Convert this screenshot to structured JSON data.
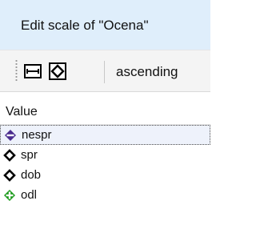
{
  "dialog": {
    "title": "Edit scale of \"Ocena\""
  },
  "toolbar": {
    "buttons": [
      {
        "icon": "fit-width-icon"
      },
      {
        "icon": "diamond-outline-icon"
      }
    ],
    "sort_label": "ascending"
  },
  "list": {
    "column_header": "Value",
    "rows": [
      {
        "label": "nespr",
        "icon": "purple-diamond-minus-icon",
        "selected": true
      },
      {
        "label": "spr",
        "icon": "black-diamond-outline-icon",
        "selected": false
      },
      {
        "label": "dob",
        "icon": "black-diamond-outline-icon",
        "selected": false
      },
      {
        "label": "odl",
        "icon": "green-diamond-plus-icon",
        "selected": false
      }
    ]
  },
  "colors": {
    "window_bg": "#dfeefb",
    "toolbar_bg": "#f4f4f4",
    "list_bg": "#ffffff",
    "selected_row_bg": "#eef2fb",
    "negative_icon": "#4b2d8f",
    "positive_icon": "#1a9a1a",
    "neutral_icon": "#000000"
  }
}
